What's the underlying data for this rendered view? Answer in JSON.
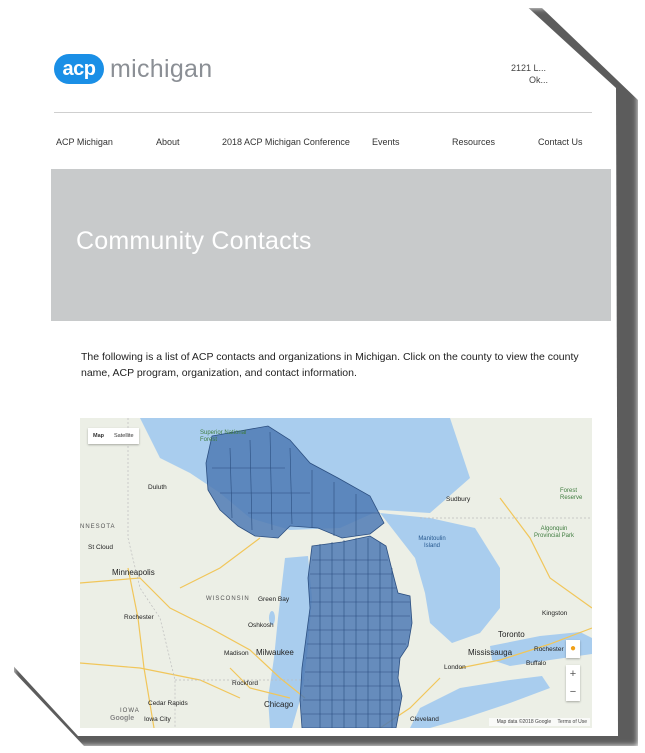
{
  "brand": {
    "logo_mark": "acp",
    "logo_word": "michigan"
  },
  "address": {
    "line1": "2121 L...",
    "line2": "Ok..."
  },
  "nav": {
    "items": [
      {
        "label": "ACP Michigan"
      },
      {
        "label": "About"
      },
      {
        "label": "2018 ACP Michigan Conference"
      },
      {
        "label": "Events"
      },
      {
        "label": "Resources"
      },
      {
        "label": "Contact Us"
      }
    ]
  },
  "hero": {
    "title": "Community Contacts",
    "background_color": "#c8cacb"
  },
  "intro": {
    "text": "The following is a list of ACP contacts and organizations in Michigan. Click on the county to view the county name, ACP program, organization, and contact information."
  },
  "map": {
    "type_toggle": {
      "map_label": "Map",
      "satellite_label": "Satellite",
      "selected": "Map"
    },
    "zoom_in_label": "+",
    "zoom_out_label": "−",
    "pegman_icon": "pegman-icon",
    "attribution": {
      "data_text": "Map data ©2018 Google",
      "terms_text": "Terms of Use"
    },
    "google_logo": "Google",
    "overlay_color": "#4f7ab4",
    "water_color": "#a9cdee",
    "place_labels": [
      {
        "text": "Superior National Forest",
        "kind": "green"
      },
      {
        "text": "Duluth",
        "kind": "city"
      },
      {
        "text": "NNESOTA",
        "kind": "state"
      },
      {
        "text": "St Cloud",
        "kind": "city"
      },
      {
        "text": "Minneapolis",
        "kind": "big"
      },
      {
        "text": "Rochester",
        "kind": "city"
      },
      {
        "text": "WISCONSIN",
        "kind": "state"
      },
      {
        "text": "Green Bay",
        "kind": "city"
      },
      {
        "text": "Oshkosh",
        "kind": "city"
      },
      {
        "text": "Madison",
        "kind": "city"
      },
      {
        "text": "Milwaukee",
        "kind": "big"
      },
      {
        "text": "Rockford",
        "kind": "city"
      },
      {
        "text": "Chicago",
        "kind": "big"
      },
      {
        "text": "Cedar Rapids",
        "kind": "city"
      },
      {
        "text": "IOWA",
        "kind": "state"
      },
      {
        "text": "Iowa City",
        "kind": "city"
      },
      {
        "text": "Sudbury",
        "kind": "city"
      },
      {
        "text": "Manitoulin Island",
        "kind": "blue"
      },
      {
        "text": "Algonquin Provincial Park",
        "kind": "green"
      },
      {
        "text": "Kingston",
        "kind": "city"
      },
      {
        "text": "Toronto",
        "kind": "big"
      },
      {
        "text": "Mississauga",
        "kind": "big"
      },
      {
        "text": "Rochester",
        "kind": "city"
      },
      {
        "text": "Buffalo",
        "kind": "city"
      },
      {
        "text": "London",
        "kind": "city"
      },
      {
        "text": "Cleveland",
        "kind": "city"
      },
      {
        "text": "Forest Reserve",
        "kind": "green"
      }
    ]
  }
}
